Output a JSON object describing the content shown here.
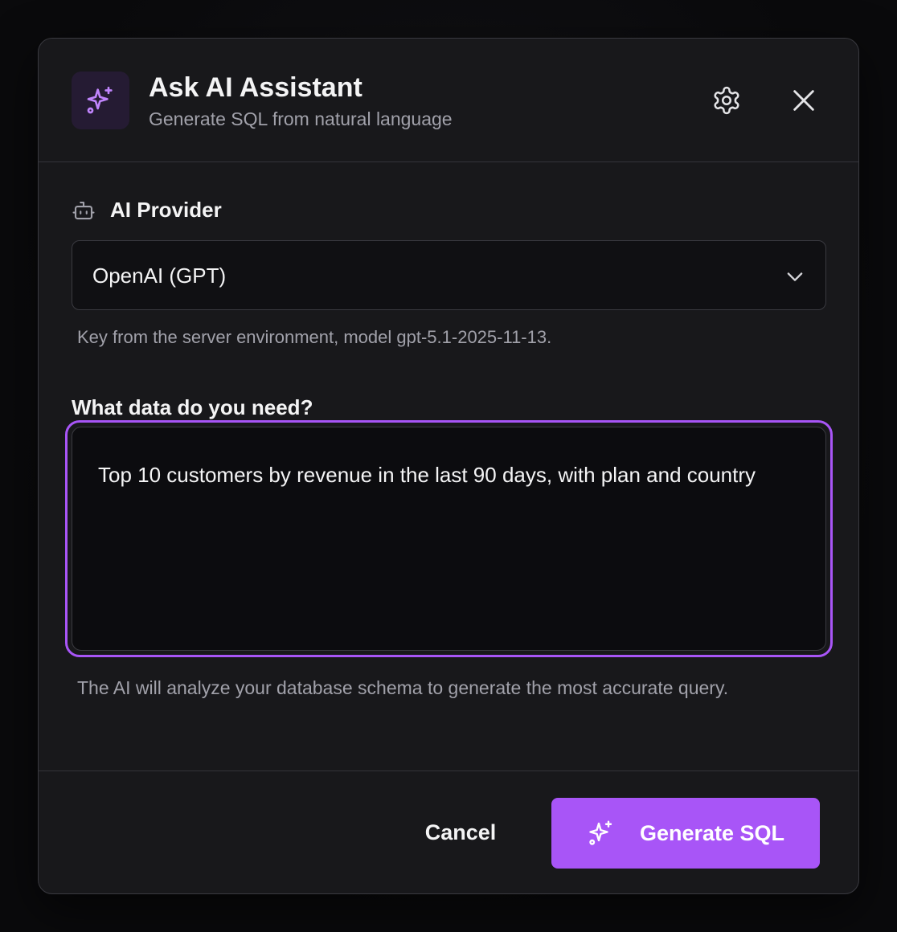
{
  "dialog": {
    "title": "Ask AI Assistant",
    "subtitle": "Generate SQL from natural language",
    "header_icon": "sparkles-icon",
    "settings_icon": "gear-icon",
    "close_icon": "close-icon"
  },
  "provider": {
    "label": "AI Provider",
    "label_icon": "bot-icon",
    "selected": "OpenAI (GPT)",
    "hint": "Key from the server environment, model gpt-5.1-2025-11-13."
  },
  "query": {
    "label": "What data do you need?",
    "value": "Top 10 customers by revenue in the last 90 days, with plan and country",
    "hint": "The AI will analyze your database schema to generate the most accurate query."
  },
  "footer": {
    "cancel_label": "Cancel",
    "generate_label": "Generate SQL",
    "generate_icon": "sparkles-icon"
  },
  "colors": {
    "accent": "#a855f7",
    "background": "#18181b",
    "text": "#f4f4f5",
    "muted": "#a1a1aa"
  }
}
